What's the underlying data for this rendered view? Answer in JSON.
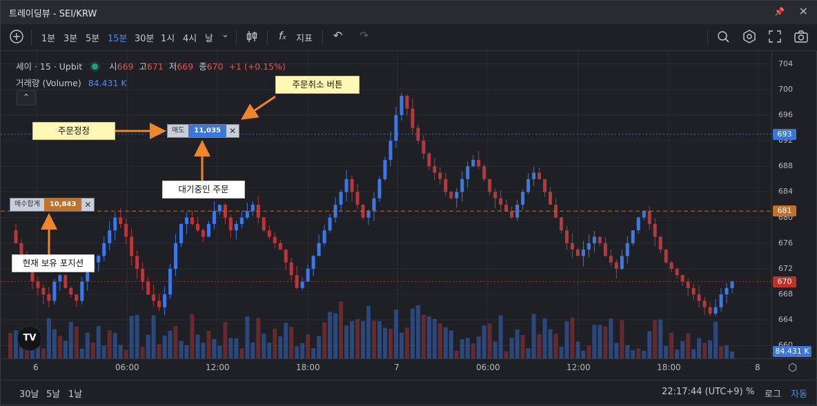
{
  "window": {
    "title": "트레이딩뷰 - SEI/KRW"
  },
  "toolbar": {
    "intervals": [
      "1분",
      "3분",
      "5분",
      "15분",
      "30분",
      "1시",
      "4시",
      "날"
    ],
    "active_interval": "15분",
    "indicators_label": "지표"
  },
  "legend": {
    "symbol": "세이 · 15 · Upbit",
    "open_label": "시",
    "open": "669",
    "high_label": "고",
    "high": "671",
    "low_label": "저",
    "low": "669",
    "close_label": "종",
    "close": "670",
    "change": "+1 (+0.15%)",
    "volume_label": "거래량 (Volume)",
    "volume_value": "84.431 K"
  },
  "orders": {
    "sell": {
      "label": "매도",
      "value": "11,035",
      "price": 693
    },
    "buy_total": {
      "label": "매수합계",
      "value": "10,843",
      "price": 681
    }
  },
  "callouts": {
    "cancel": "주문취소 버튼",
    "modify": "주문정정",
    "pending": "대기중인 주문",
    "position": "현재 보유 포지션"
  },
  "price_axis": {
    "ticks": [
      "704",
      "700",
      "696",
      "692",
      "688",
      "684",
      "680",
      "676",
      "672",
      "668",
      "664",
      "660"
    ],
    "tags": {
      "sell": "693",
      "buy": "681",
      "last": "670",
      "volume": "84.431 K"
    }
  },
  "time_axis": {
    "ticks": [
      "6",
      "06:00",
      "12:00",
      "18:00",
      "7",
      "06:00",
      "12:00",
      "18:00",
      "8"
    ]
  },
  "bottom": {
    "ranges": [
      "30날",
      "5날",
      "1날"
    ],
    "clock": "22:17:44 (UTC+9)",
    "percent": "%",
    "log": "로그",
    "auto": "자동"
  },
  "colors": {
    "up": "#3a79e6",
    "down": "#b8383a",
    "sell_blue": "#3c76d8",
    "buy_orange": "#c2702a",
    "last_red": "#c0302a"
  },
  "chart_data": {
    "type": "candlestick",
    "symbol": "SEI/KRW",
    "interval": "15분",
    "ylim": [
      658,
      706
    ],
    "x_ticks": [
      "6",
      "06:00",
      "12:00",
      "18:00",
      "7",
      "06:00",
      "12:00",
      "18:00",
      "8"
    ],
    "price_path_approx": [
      678,
      676,
      674,
      672,
      670,
      669,
      668,
      667,
      670,
      671,
      669,
      668,
      667,
      670,
      672,
      673,
      674,
      676,
      678,
      680,
      679,
      677,
      674,
      672,
      670,
      668,
      667,
      666,
      668,
      672,
      676,
      679,
      680,
      679,
      678,
      677,
      679,
      681,
      682,
      680,
      678,
      679,
      680,
      681,
      682,
      680,
      678,
      677,
      676,
      675,
      673,
      671,
      669,
      670,
      672,
      674,
      676,
      678,
      680,
      682,
      684,
      686,
      684,
      682,
      680,
      681,
      683,
      686,
      689,
      692,
      696,
      699,
      697,
      694,
      692,
      690,
      688,
      687,
      686,
      684,
      683,
      684,
      686,
      688,
      689,
      688,
      686,
      684,
      683,
      682,
      681,
      680,
      682,
      684,
      686,
      687,
      686,
      684,
      682,
      680,
      678,
      676,
      675,
      674,
      675,
      676,
      677,
      676,
      674,
      673,
      672,
      674,
      676,
      678,
      680,
      681,
      679,
      677,
      675,
      673,
      672,
      671,
      670,
      669,
      668,
      667,
      666,
      665,
      666,
      668,
      669,
      670
    ],
    "horizontal_lines": [
      {
        "name": "매도",
        "value": 693
      },
      {
        "name": "매수합계",
        "value": 681
      },
      {
        "name": "last",
        "value": 670
      }
    ],
    "volume_last": "84.431 K"
  }
}
